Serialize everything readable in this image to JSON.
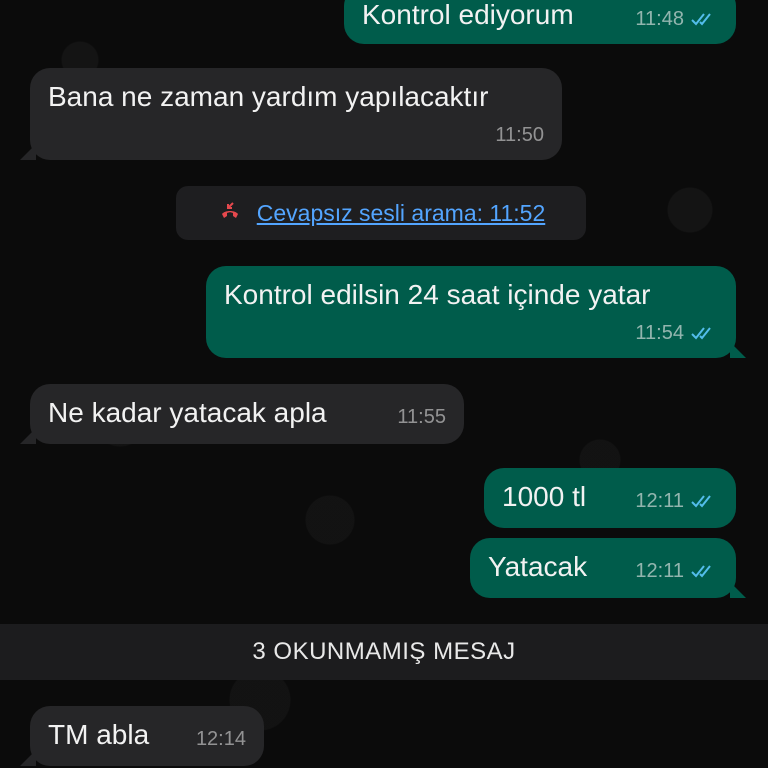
{
  "messages": [
    {
      "id": "m1",
      "direction": "outgoing",
      "text": "Kontrol ediyorum",
      "time": "11:48",
      "status": "read"
    },
    {
      "id": "m2",
      "direction": "incoming",
      "text": "Bana ne zaman yardım yapılacaktır",
      "time": "11:50"
    },
    {
      "id": "m3",
      "direction": "outgoing",
      "text": "Kontrol edilsin 24 saat içinde yatar",
      "time": "11:54",
      "status": "read"
    },
    {
      "id": "m4",
      "direction": "incoming",
      "text": "Ne kadar yatacak apla",
      "time": "11:55"
    },
    {
      "id": "m5",
      "direction": "outgoing",
      "text": "1000 tl",
      "time": "12:11",
      "status": "read"
    },
    {
      "id": "m6",
      "direction": "outgoing",
      "text": "Yatacak",
      "time": "12:11",
      "status": "read"
    },
    {
      "id": "m7",
      "direction": "incoming",
      "text": "TM abla",
      "time": "12:14"
    }
  ],
  "missed_call": {
    "label": "Cevapsız sesli arama: 11:52",
    "icon": "missed-call-icon"
  },
  "unread_banner": {
    "label": "3 OKUNMAMIŞ MESAJ"
  },
  "colors": {
    "background": "#0b0b0b",
    "incoming_bubble": "#262628",
    "outgoing_bubble": "#005c4b",
    "read_ticks": "#53bdeb",
    "missed_call_icon": "#e5484d",
    "link": "#53a5ff"
  }
}
